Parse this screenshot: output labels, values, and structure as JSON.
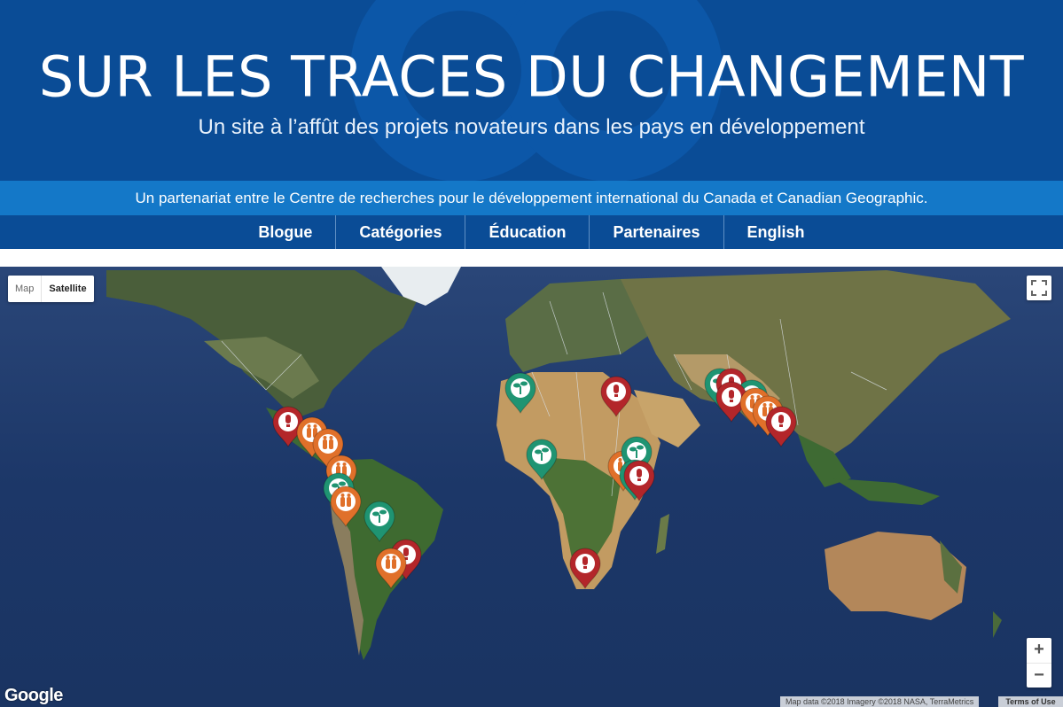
{
  "header": {
    "title": "SUR LES TRACES DU CHANGEMENT",
    "subtitle": "Un site à l’affût des projets novateurs dans les pays en développement",
    "partner_text": "Un partenariat entre le Centre de recherches pour le développement international du Canada et Canadian Geographic."
  },
  "nav": {
    "items": [
      {
        "label": "Blogue"
      },
      {
        "label": "Catégories"
      },
      {
        "label": "Éducation"
      },
      {
        "label": "Partenaires"
      },
      {
        "label": "English"
      }
    ]
  },
  "map": {
    "type_controls": {
      "map_label": "Map",
      "satellite_label": "Satellite",
      "selected": "Satellite"
    },
    "zoom": {
      "in_label": "+",
      "out_label": "−"
    },
    "logo_text": "Google",
    "attribution": "Map data ©2018 Imagery ©2018 NASA, TerraMetrics",
    "terms_label": "Terms of Use",
    "marker_types": {
      "red": {
        "color": "#b3262a",
        "icon": "lightbulb-icon"
      },
      "orange": {
        "color": "#e0702a",
        "icon": "people-icon"
      },
      "green": {
        "color": "#1f9472",
        "icon": "plant-icon"
      }
    }
  }
}
